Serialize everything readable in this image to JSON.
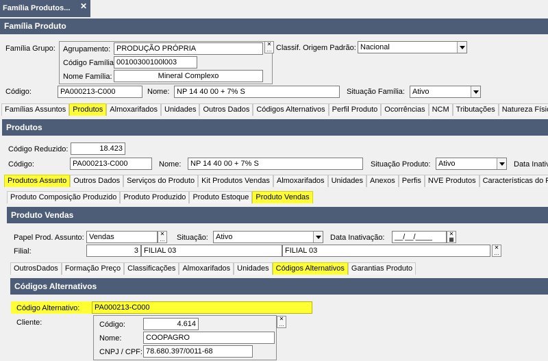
{
  "window": {
    "tab_title": "Família Produtos...",
    "close_glyph": "✕"
  },
  "familia": {
    "header": "Família Produto",
    "grupo_label": "Família Grupo:",
    "agrupamento_label": "Agrupamento:",
    "agrupamento_value": "PRODUÇÃO PRÓPRIA",
    "codigo_familia_label": "Código Família:",
    "codigo_familia_value": "00100300100l003",
    "nome_familia_label": "Nome Família:",
    "nome_familia_value": "Mineral Complexo",
    "classif_label": "Classif. Origem Padrão:",
    "classif_value": "Nacional",
    "codigo_label": "Código:",
    "codigo_value": "PA000213-C000",
    "nome_label": "Nome:",
    "nome_value": "NP 14 40 00 + 7% S",
    "situacao_label": "Situação Família:",
    "situacao_value": "Ativo"
  },
  "tabs1": [
    "Famílias Assuntos",
    "Produtos",
    "Almoxarifados",
    "Unidades",
    "Outros Dados",
    "Códigos Alternativos",
    "Perfil Produto",
    "Ocorrências",
    "NCM",
    "Tributações",
    "Natureza Físic"
  ],
  "produtos": {
    "header": "Produtos",
    "codigo_reduzido_label": "Código Reduzido:",
    "codigo_reduzido_value": "18.423",
    "codigo_label": "Código:",
    "codigo_value": "PA000213-C000",
    "nome_label": "Nome:",
    "nome_value": "NP 14 40 00 + 7% S",
    "situacao_label": "Situação Produto:",
    "situacao_value": "Ativo",
    "data_inativ_label": "Data Inativ"
  },
  "tabs2": [
    "Produtos Assunto",
    "Outros Dados",
    "Serviços do Produto",
    "Kit Produtos Vendas",
    "Almoxarifados",
    "Unidades",
    "Anexos",
    "Perfis",
    "NVE Produtos",
    "Características do Pr"
  ],
  "tabs3": [
    "Produto Composição Produzido",
    "Produto Produzido",
    "Produto Estoque",
    "Produto Vendas"
  ],
  "vendas": {
    "header": "Produto Vendas",
    "papel_label": "Papel Prod. Assunto:",
    "papel_value": "Vendas",
    "situacao_label": "Situação:",
    "situacao_value": "Ativo",
    "data_inativacao_label": "Data Inativação:",
    "data_inativacao_value": "__/__/____",
    "filial_label": "Filial:",
    "filial_num": "3",
    "filial_nome": "FILIAL 03",
    "filial_nome2": "FILIAL 03"
  },
  "tabs4": [
    "OutrosDados",
    "Formação Preço",
    "Classificações",
    "Almoxarifados",
    "Unidades",
    "Códigos Alternativos",
    "Garantias Produto"
  ],
  "codalt": {
    "header": "Códigos Alternativos",
    "codigo_alt_label": "Código Alternativo:",
    "codigo_alt_value": "PA000213-C000",
    "cliente_label": "Cliente:",
    "cli_codigo_label": "Código:",
    "cli_codigo_value": "4.614",
    "cli_nome_label": "Nome:",
    "cli_nome_value": "COOPAGRO",
    "cli_cnpj_label": "CNPJ / CPF:",
    "cli_cnpj_value": "78.680.397/0011-68"
  },
  "colors": {
    "header_bg": "#4e5d77",
    "highlight": "#ffff33"
  }
}
